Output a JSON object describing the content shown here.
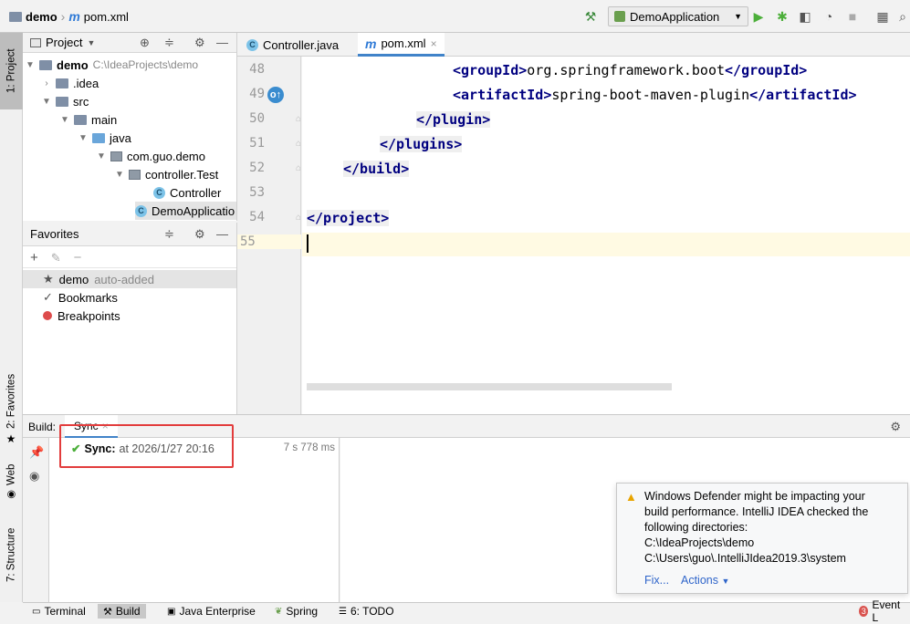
{
  "navbar": {
    "project": "demo",
    "file": "pom.xml",
    "run_config": "DemoApplication"
  },
  "left_stripe": {
    "project_tab": "1: Project",
    "favorites_tab": "2: Favorites",
    "web_tab": "Web",
    "structure_tab": "7: Structure"
  },
  "project_panel": {
    "title": "Project",
    "tree": [
      {
        "label": "demo",
        "extra": "C:\\IdeaProjects\\demo"
      },
      {
        "label": ".idea"
      },
      {
        "label": "src"
      },
      {
        "label": "main"
      },
      {
        "label": "java"
      },
      {
        "label": "com.guo.demo"
      },
      {
        "label": "controller.Test"
      },
      {
        "label": "Controller"
      },
      {
        "label": "DemoApplicatio"
      }
    ]
  },
  "favorites_panel": {
    "title": "Favorites",
    "items": [
      {
        "label": "demo",
        "note": "auto-added"
      },
      {
        "label": "Bookmarks"
      },
      {
        "label": "Breakpoints"
      }
    ]
  },
  "editor": {
    "tabs": [
      {
        "label": "Controller.java"
      },
      {
        "label": "pom.xml"
      }
    ],
    "lines": [
      {
        "num": "48",
        "open": "<groupId>",
        "text": "org.springframework.boot",
        "close": "</groupId>"
      },
      {
        "num": "49",
        "open": "<artifactId>",
        "text": "spring-boot-maven-plugin",
        "close": "</artifactId>"
      },
      {
        "num": "50",
        "close": "</plugin>"
      },
      {
        "num": "51",
        "close": "</plugins>"
      },
      {
        "num": "52",
        "close": "</build>"
      },
      {
        "num": "53"
      },
      {
        "num": "54",
        "close": "</project>"
      },
      {
        "num": "55"
      }
    ]
  },
  "build": {
    "label": "Build:",
    "tab": "Sync",
    "sync_title": "Sync:",
    "sync_time": "at 2026/1/27 20:16",
    "duration": "7 s 778 ms"
  },
  "notification": {
    "lines": [
      "Windows Defender might be impacting your",
      "build performance. IntelliJ IDEA checked the",
      "following directories:",
      "C:\\IdeaProjects\\demo",
      "C:\\Users\\guo\\.IntelliJIdea2019.3\\system"
    ],
    "fix": "Fix...",
    "actions": "Actions"
  },
  "bottom_bar": {
    "tabs": [
      "Terminal",
      "Build",
      "Java Enterprise",
      "Spring",
      "6: TODO"
    ],
    "event_log": "Event L",
    "event_count": "3"
  },
  "colors": {
    "xml_tag": "#000080",
    "accent": "#4083c9",
    "caret_line": "#fffae3",
    "highlight_box": "#e23c3c"
  }
}
